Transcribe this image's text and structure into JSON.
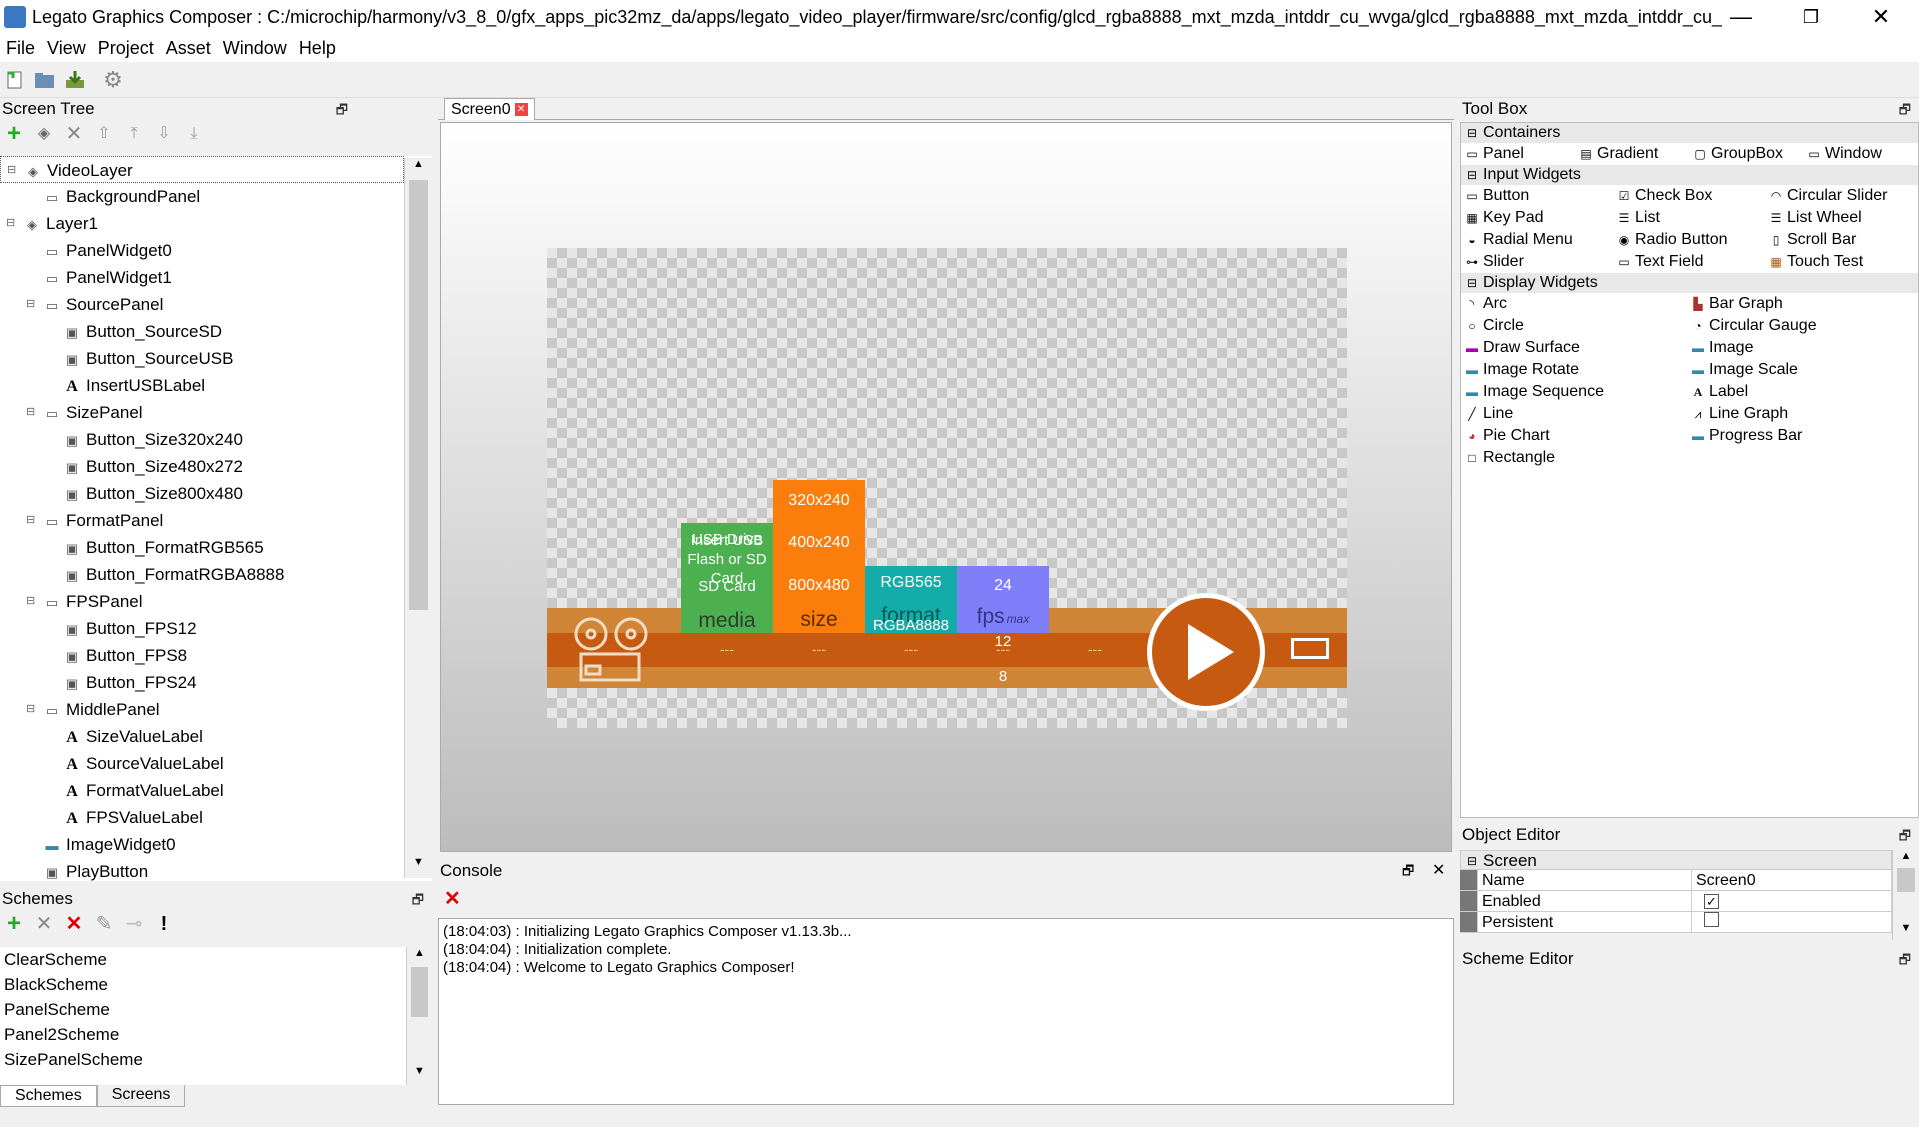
{
  "window": {
    "title": "Legato Graphics Composer : C:/microchip/harmony/v3_8_0/gfx_apps_pic32mz_da/apps/legato_video_player/firmware/src/config/glcd_rgba8888_mxt_mzda_intddr_cu_wvga/glcd_rgba8888_mxt_mzda_intddr_cu_...",
    "minimize": "—",
    "maximize": "❐",
    "close": "✕"
  },
  "menu": [
    "File",
    "View",
    "Project",
    "Asset",
    "Window",
    "Help"
  ],
  "screen_tree": {
    "title": "Screen Tree",
    "items": [
      {
        "label": "VideoLayer",
        "level": 0
      },
      {
        "label": "BackgroundPanel",
        "level": 1
      },
      {
        "label": "Layer1",
        "level": 0
      },
      {
        "label": "PanelWidget0",
        "level": 1
      },
      {
        "label": "PanelWidget1",
        "level": 1
      },
      {
        "label": "SourcePanel",
        "level": 1
      },
      {
        "label": "Button_SourceSD",
        "level": 2
      },
      {
        "label": "Button_SourceUSB",
        "level": 2
      },
      {
        "label": "InsertUSBLabel",
        "level": 2
      },
      {
        "label": "SizePanel",
        "level": 1
      },
      {
        "label": "Button_Size320x240",
        "level": 2
      },
      {
        "label": "Button_Size480x272",
        "level": 2
      },
      {
        "label": "Button_Size800x480",
        "level": 2
      },
      {
        "label": "FormatPanel",
        "level": 1
      },
      {
        "label": "Button_FormatRGB565",
        "level": 2
      },
      {
        "label": "Button_FormatRGBA8888",
        "level": 2
      },
      {
        "label": "FPSPanel",
        "level": 1
      },
      {
        "label": "Button_FPS12",
        "level": 2
      },
      {
        "label": "Button_FPS8",
        "level": 2
      },
      {
        "label": "Button_FPS24",
        "level": 2
      },
      {
        "label": "MiddlePanel",
        "level": 1
      },
      {
        "label": "SizeValueLabel",
        "level": 2
      },
      {
        "label": "SourceValueLabel",
        "level": 2
      },
      {
        "label": "FormatValueLabel",
        "level": 2
      },
      {
        "label": "FPSValueLabel",
        "level": 2
      },
      {
        "label": "ImageWidget0",
        "level": 1
      },
      {
        "label": "PlayButton",
        "level": 1
      }
    ]
  },
  "schemes": {
    "title": "Schemes",
    "items": [
      "ClearScheme",
      "BlackScheme",
      "PanelScheme",
      "Panel2Scheme",
      "SizePanelScheme"
    ],
    "tabs": [
      "Schemes",
      "Screens"
    ]
  },
  "editor": {
    "tab": "Screen0",
    "canvas": {
      "usb_text": "USB Drive",
      "insert_text": "Insert USB Flash or SD Card",
      "sd_text": "SD Card",
      "media": "media",
      "sizes": [
        "320x240",
        "400x240",
        "800x480"
      ],
      "size_label": "size",
      "formats": [
        "RGB565",
        "RGBA8888"
      ],
      "format_label": "format",
      "fps": [
        "24",
        "12",
        "8"
      ],
      "fps_label": "fps",
      "fps_sub": "max",
      "dashes": [
        "---",
        "---",
        "---",
        "---",
        "---"
      ]
    }
  },
  "console": {
    "title": "Console",
    "lines": [
      "(18:04:03) : Initializing Legato Graphics Composer v1.13.3b...",
      "(18:04:04) : Initialization complete.",
      "(18:04:04) : Welcome to Legato Graphics Composer!"
    ]
  },
  "toolbox": {
    "title": "Tool Box",
    "containers": {
      "title": "Containers",
      "items": [
        "Panel",
        "Gradient",
        "GroupBox",
        "Window"
      ]
    },
    "input": {
      "title": "Input Widgets",
      "items": [
        "Button",
        "Check Box",
        "Circular Slider",
        "Key Pad",
        "List",
        "List Wheel",
        "Radial Menu",
        "Radio Button",
        "Scroll Bar",
        "Slider",
        "Text Field",
        "Touch Test"
      ]
    },
    "display": {
      "title": "Display Widgets",
      "items": [
        "Arc",
        "Bar Graph",
        "Circle",
        "Circular Gauge",
        "Draw Surface",
        "Image",
        "Image Rotate",
        "Image Scale",
        "Image Sequence",
        "Label",
        "Line",
        "Line Graph",
        "Pie Chart",
        "Progress Bar",
        "Rectangle"
      ]
    }
  },
  "object_editor": {
    "title": "Object Editor",
    "group": "Screen",
    "rows": [
      {
        "name": "Name",
        "value": "Screen0"
      },
      {
        "name": "Enabled",
        "value": "✓"
      },
      {
        "name": "Persistent",
        "value": ""
      }
    ]
  },
  "scheme_editor": {
    "title": "Scheme Editor"
  }
}
